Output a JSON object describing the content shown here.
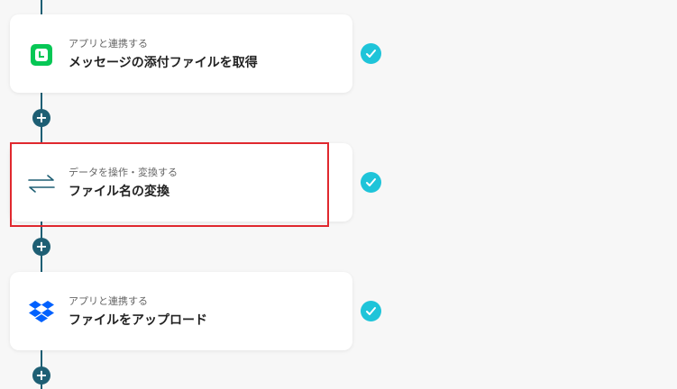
{
  "steps": [
    {
      "subtitle": "アプリと連携する",
      "title": "メッセージの添付ファイルを取得",
      "icon": "line-app-icon",
      "status": "completed"
    },
    {
      "subtitle": "データを操作・変換する",
      "title": "ファイル名の変換",
      "icon": "swap-arrows-icon",
      "status": "completed"
    },
    {
      "subtitle": "アプリと連携する",
      "title": "ファイルをアップロード",
      "icon": "dropbox-icon",
      "status": "completed"
    }
  ],
  "add_label": "+",
  "colors": {
    "connector": "#1e5f74",
    "check": "#1ec4d9",
    "highlight": "#e0282e",
    "line_green": "#06c755",
    "dropbox_blue": "#0061fe"
  }
}
